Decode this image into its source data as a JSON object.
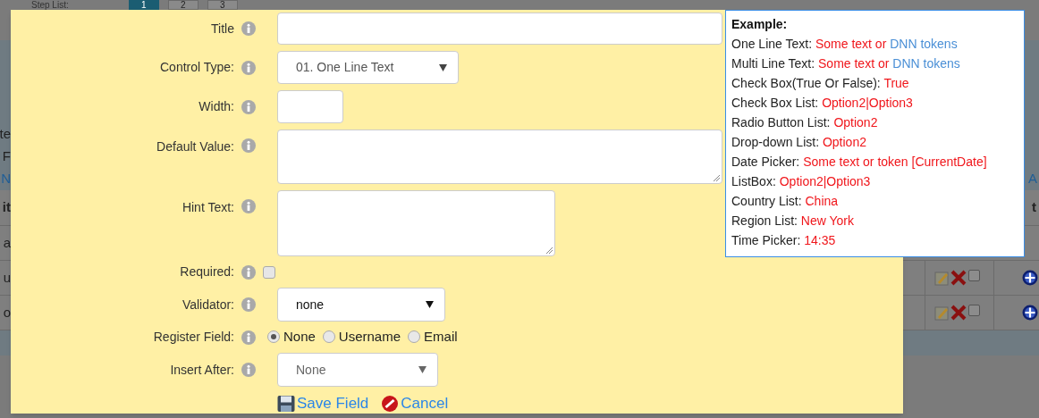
{
  "background_page": {
    "step_list_label": "Step List:",
    "step_tabs": [
      {
        "label": "1",
        "selected": true
      },
      {
        "label": "2",
        "selected": false
      },
      {
        "label": "3",
        "selected": false
      }
    ],
    "left_edge": {
      "lines": [
        {
          "text": "te",
          "kind": "plain"
        },
        {
          "text": "F",
          "kind": "plain"
        },
        {
          "text": "N",
          "kind": "link"
        }
      ],
      "table_header": "it",
      "rows": [
        "a",
        "u",
        "o"
      ]
    },
    "right_edge": {
      "link": "A",
      "table_header": "t",
      "rows": [
        {
          "checked": false
        },
        {
          "checked": false
        }
      ]
    }
  },
  "dialog": {
    "rows": [
      {
        "kind": "text",
        "label": "Title"
      },
      {
        "kind": "select",
        "label": "Control Type:",
        "value": "01. One Line Text"
      },
      {
        "kind": "text",
        "label": "Width:"
      },
      {
        "kind": "textarea",
        "label": "Default Value:"
      },
      {
        "kind": "textarea",
        "label": "Hint Text:"
      },
      {
        "kind": "checkbox",
        "label": "Required:",
        "checked": false
      },
      {
        "kind": "select",
        "label": "Validator:",
        "value": "none"
      },
      {
        "kind": "radios",
        "label": "Register Field:",
        "options": [
          {
            "label": "None",
            "selected": true
          },
          {
            "label": "Username",
            "selected": false
          },
          {
            "label": "Email",
            "selected": false
          }
        ]
      },
      {
        "kind": "select",
        "label": "Insert After:",
        "value": "None"
      }
    ],
    "actions": [
      {
        "kind": "save",
        "label": "Save Field"
      },
      {
        "kind": "cancel",
        "label": "Cancel"
      }
    ]
  },
  "tooltip": {
    "heading": "Example:",
    "items": [
      {
        "label": "One Line Text:",
        "value": [
          {
            "text": "Some text or",
            "kind": "example"
          },
          {
            "text": "DNN tokens",
            "kind": "token"
          }
        ]
      },
      {
        "label": "Multi Line Text:",
        "value": [
          {
            "text": "Some text or",
            "kind": "example"
          },
          {
            "text": "DNN tokens",
            "kind": "token"
          }
        ]
      },
      {
        "label": "Check Box(True Or False):",
        "value": [
          {
            "text": "True",
            "kind": "example"
          }
        ]
      },
      {
        "label": "Check Box List:",
        "value": [
          {
            "text": "Option2|Option3",
            "kind": "example"
          }
        ]
      },
      {
        "label": "Radio Button List:",
        "value": [
          {
            "text": "Option2",
            "kind": "example"
          }
        ]
      },
      {
        "label": "Drop-down List:",
        "value": [
          {
            "text": "Option2",
            "kind": "example"
          }
        ]
      },
      {
        "label": "Date Picker:",
        "value": [
          {
            "text": "Some text or token [CurrentDate]",
            "kind": "example"
          }
        ]
      },
      {
        "label": "ListBox:",
        "value": [
          {
            "text": "Option2|Option3",
            "kind": "example"
          }
        ]
      },
      {
        "label": "Country List:",
        "value": [
          {
            "text": "China",
            "kind": "example"
          }
        ]
      },
      {
        "label": "Region List:",
        "value": [
          {
            "text": "New York",
            "kind": "example"
          }
        ]
      },
      {
        "label": "Time Picker:",
        "value": [
          {
            "text": "14:35",
            "kind": "example"
          }
        ]
      }
    ]
  }
}
